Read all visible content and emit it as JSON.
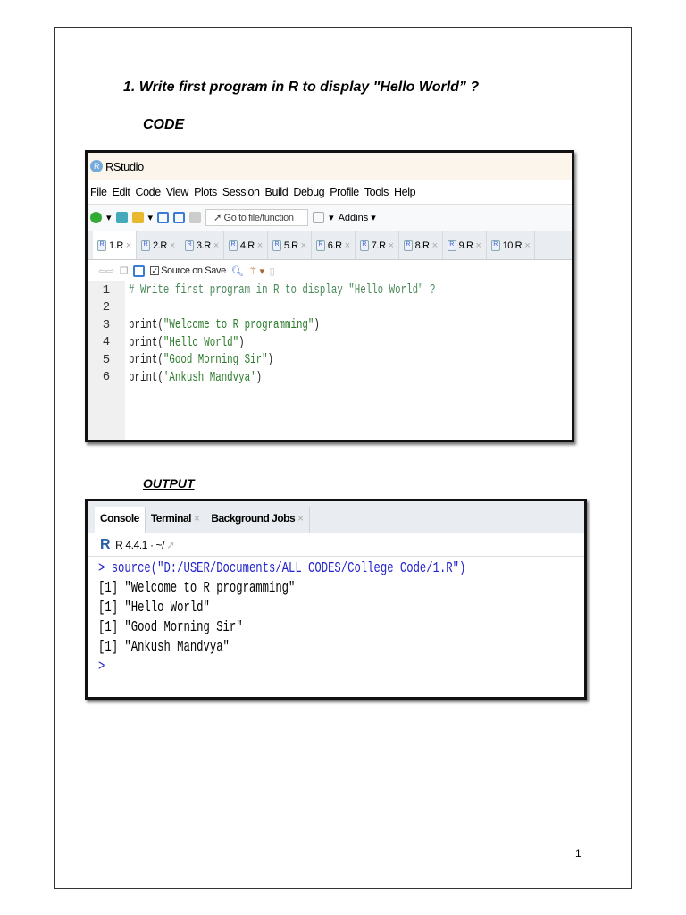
{
  "heading": "1.  Write first program in R to display \"Hello World” ?",
  "code_label": "CODE",
  "output_label": "OUTPUT",
  "page_number": "1",
  "rstudio": {
    "title": "RStudio",
    "menu": [
      "File",
      "Edit",
      "Code",
      "View",
      "Plots",
      "Session",
      "Build",
      "Debug",
      "Profile",
      "Tools",
      "Help"
    ],
    "goto_placeholder": "Go to file/function",
    "addins": "Addins",
    "tabs": [
      "1.R",
      "2.R",
      "3.R",
      "4.R",
      "5.R",
      "6.R",
      "7.R",
      "8.R",
      "9.R",
      "10.R"
    ],
    "source_on_save": "Source on Save",
    "lines": [
      {
        "n": "1",
        "text": "# Write first program in R to display \"Hello World\" ?",
        "type": "comment"
      },
      {
        "n": "2",
        "text": "",
        "type": "blank"
      },
      {
        "n": "3",
        "fn": "print(",
        "str": "\"Welcome to R programming\"",
        "end": ")"
      },
      {
        "n": "4",
        "fn": "print(",
        "str": "\"Hello World\"",
        "end": ")"
      },
      {
        "n": "5",
        "fn": "print(",
        "str": "\"Good Morning Sir\"",
        "end": ")"
      },
      {
        "n": "6",
        "fn": "print(",
        "str": "'Ankush Mandvya'",
        "end": ")"
      }
    ]
  },
  "console": {
    "tabs": [
      "Console",
      "Terminal",
      "Background Jobs"
    ],
    "r_version": "R 4.4.1 · ~/",
    "command": "> source(\"D:/USER/Documents/ALL CODES/College Code/1.R\")",
    "outputs": [
      "[1] \"Welcome to R programming\"",
      "[1] \"Hello World\"",
      "[1] \"Good Morning Sir\"",
      "[1] \"Ankush Mandvya\""
    ],
    "prompt": ">"
  }
}
